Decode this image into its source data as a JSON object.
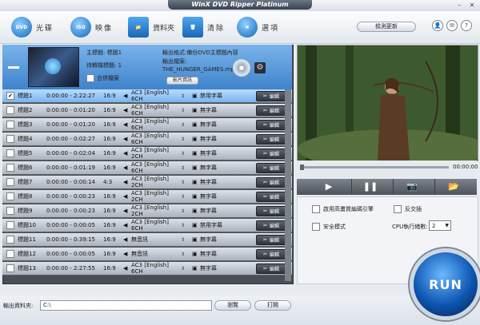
{
  "window": {
    "title": "WinX DVD Ripper Platinum",
    "min": "–",
    "close": "✕"
  },
  "toolbar": {
    "dvd_icon": "DVD",
    "dvd_label": "光碟",
    "iso_icon": "ISO",
    "iso_label": "映像",
    "folder_label": "資料夾",
    "delete_label": "清除",
    "options_label": "選項",
    "update_label": "檢測更新"
  },
  "source": {
    "main_title": "主標題: 標題1",
    "output_count": "待轉檔標題: 1",
    "merge_label": "合併檔案",
    "output_format": "輸出格式:備份DVD主標題內容",
    "output_file_label": "輸出檔案:",
    "output_file": "THE_HUNGER_GAMES.mp",
    "edit_info_label": "影片資訊"
  },
  "titles": [
    {
      "check": "✔",
      "title": "標題1",
      "time": "0:00:00 - 2:22:27",
      "ratio": "16:9",
      "audio": "AC3 [English] 6CH",
      "subtitle": "禁用字幕",
      "edit": "編輯",
      "selected": true
    },
    {
      "check": "",
      "title": "標題2",
      "time": "0:00:00 - 0:01:20",
      "ratio": "16:9",
      "audio": "AC3 [English] 6CH",
      "subtitle": "無字幕",
      "edit": "編輯",
      "selected": false
    },
    {
      "check": "",
      "title": "標題3",
      "time": "0:00:00 - 0:01:20",
      "ratio": "16:9",
      "audio": "AC3 [English] 6CH",
      "subtitle": "無字幕",
      "edit": "編輯",
      "selected": false
    },
    {
      "check": "",
      "title": "標題4",
      "time": "0:00:00 - 0:02:27",
      "ratio": "16:9",
      "audio": "AC3 [English] 6CH",
      "subtitle": "無字幕",
      "edit": "編輯",
      "selected": false
    },
    {
      "check": "",
      "title": "標題5",
      "time": "0:00:00 - 0:02:04",
      "ratio": "16:9",
      "audio": "AC3 [English] 2CH",
      "subtitle": "無字幕",
      "edit": "編輯",
      "selected": false
    },
    {
      "check": "",
      "title": "標題6",
      "time": "0:00:00 - 0:01:19",
      "ratio": "16:9",
      "audio": "AC3 [English] 6CH",
      "subtitle": "無字幕",
      "edit": "編輯",
      "selected": false
    },
    {
      "check": "",
      "title": "標題7",
      "time": "0:00:00 - 0:00:14",
      "ratio": "4:3",
      "audio": "AC3 [English] 2CH",
      "subtitle": "無字幕",
      "edit": "編輯",
      "selected": false
    },
    {
      "check": "",
      "title": "標題8",
      "time": "0:00:00 - 0:00:23",
      "ratio": "16:9",
      "audio": "AC3 [English] 2CH",
      "subtitle": "無字幕",
      "edit": "編輯",
      "selected": false
    },
    {
      "check": "",
      "title": "標題9",
      "time": "0:00:00 - 0:00:23",
      "ratio": "16:9",
      "audio": "AC3 [English] 2CH",
      "subtitle": "無字幕",
      "edit": "編輯",
      "selected": false
    },
    {
      "check": "",
      "title": "標題10",
      "time": "0:00:00 - 0:00:05",
      "ratio": "16:9",
      "audio": "AC3 [English] 6CH",
      "subtitle": "禁用字幕",
      "edit": "編輯",
      "selected": false
    },
    {
      "check": "",
      "title": "標題11",
      "time": "0:00:00 - 0:39:15",
      "ratio": "16:9",
      "audio": "無音訊",
      "subtitle": "無字幕",
      "edit": "編輯",
      "selected": false
    },
    {
      "check": "",
      "title": "標題12",
      "time": "0:00:00 - 0:00:05",
      "ratio": "16:9",
      "audio": "無音訊",
      "subtitle": "無字幕",
      "edit": "編輯",
      "selected": false
    },
    {
      "check": "",
      "title": "標題13",
      "time": "0:00:00 - 2:27:55",
      "ratio": "16:9",
      "audio": "AC3 [English] 6CH",
      "subtitle": "無字幕",
      "edit": "編輯",
      "selected": false
    }
  ],
  "player": {
    "time": "00:00:00"
  },
  "options": {
    "hq_engine": "啟用高畫質編碼引擎",
    "deinterlace": "反交插",
    "safe_mode": "安全模式",
    "cpu_label": "CPU執行緒數:",
    "cpu_value": "2"
  },
  "bottom": {
    "output_folder_label": "輸出資料夾:",
    "output_folder_value": "C:\\",
    "browse_label": "瀏覽",
    "open_label": "打開"
  },
  "run": {
    "label": "RUN"
  }
}
